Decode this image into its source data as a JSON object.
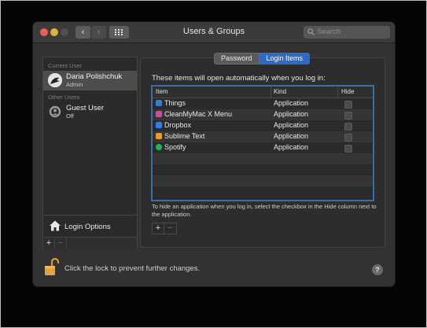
{
  "window": {
    "title": "Users & Groups",
    "search_placeholder": "Search"
  },
  "nav": {
    "back": "‹",
    "forward": "›"
  },
  "sidebar": {
    "current_user_label": "Current User",
    "current_user": {
      "name": "Daria Polishchuk",
      "role": "Admin"
    },
    "other_users_label": "Other Users",
    "guest_user": {
      "name": "Guest User",
      "status": "Off"
    },
    "login_options": "Login Options",
    "add": "+",
    "remove": "−"
  },
  "tabs": [
    "Password",
    "Login Items"
  ],
  "active_tab": "Login Items",
  "login_items": {
    "intro": "These items will open automatically when you log in:",
    "columns": {
      "item": "Item",
      "kind": "Kind",
      "hide": "Hide"
    },
    "rows": [
      {
        "item": "Things",
        "kind": "Application",
        "icon": "things-icon",
        "color": "#3b7bd8",
        "hide": false
      },
      {
        "item": "CleanMyMac X Menu",
        "kind": "Application",
        "icon": "cleanmymac-icon",
        "color": "#c94fa0",
        "hide": false
      },
      {
        "item": "Dropbox",
        "kind": "Application",
        "icon": "dropbox-icon",
        "color": "#2f7df6",
        "hide": false
      },
      {
        "item": "Sublime Text",
        "kind": "Application",
        "icon": "sublime-icon",
        "color": "#f39a1e",
        "hide": false
      },
      {
        "item": "Spotify",
        "kind": "Application",
        "icon": "spotify-icon",
        "color": "#1db954",
        "hide": false
      }
    ],
    "hint": "To hide an application when you log in, select the checkbox in the Hide column next to the application.",
    "add": "+",
    "remove": "−"
  },
  "lock_text": "Click the lock to prevent further changes.",
  "help": "?",
  "colors": {
    "accent": "#2f6bc4",
    "table_focus": "#3a6ea8",
    "lock": "#e6a23c"
  }
}
